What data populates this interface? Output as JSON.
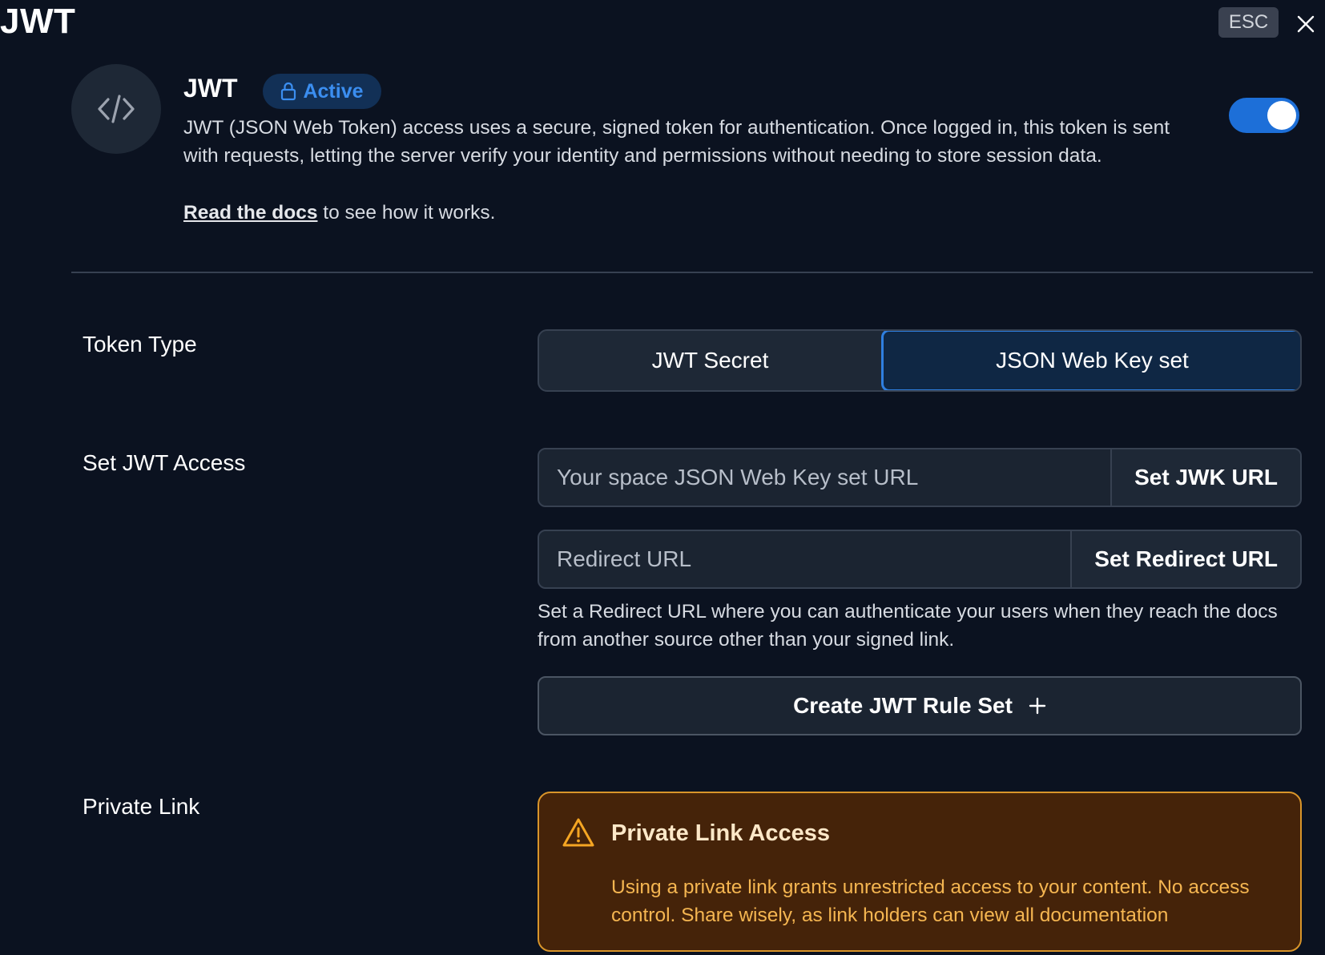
{
  "top": {
    "title": "JWT",
    "esc_label": "ESC"
  },
  "header": {
    "name": "JWT",
    "badge": "Active",
    "description": "JWT (JSON Web Token) access uses a secure, signed token for authentication. Once logged in, this token is sent with requests, letting the server verify your identity and permissions without needing to store session data.",
    "docs_link": "Read the docs",
    "docs_suffix": " to see how it works.",
    "enabled": true
  },
  "token_type": {
    "label": "Token Type",
    "options": [
      "JWT Secret",
      "JSON Web Key set"
    ],
    "selected": "JSON Web Key set"
  },
  "access": {
    "label": "Set JWT Access",
    "jwk_placeholder": "Your space JSON Web Key set URL",
    "jwk_button": "Set JWK URL",
    "redirect_placeholder": "Redirect URL",
    "redirect_button": "Set Redirect URL",
    "redirect_help": "Set a Redirect URL where you can authenticate your users when they reach the docs from another source other than your signed link.",
    "create_rule_button": "Create JWT Rule Set"
  },
  "private_link": {
    "label": "Private Link",
    "warning_title": "Private Link Access",
    "warning_text": "Using a private link grants unrestricted access to your content. No access control. Share wisely, as link holders can view all documentation"
  },
  "icons": [
    "close-icon",
    "code-icon",
    "lock-icon",
    "plus-icon",
    "warning-icon"
  ],
  "colors": {
    "background": "#0b1220",
    "accent": "#2f7fe0",
    "warning_border": "#d9952a",
    "warning_bg": "#452309",
    "warning_text": "#f5b651"
  }
}
